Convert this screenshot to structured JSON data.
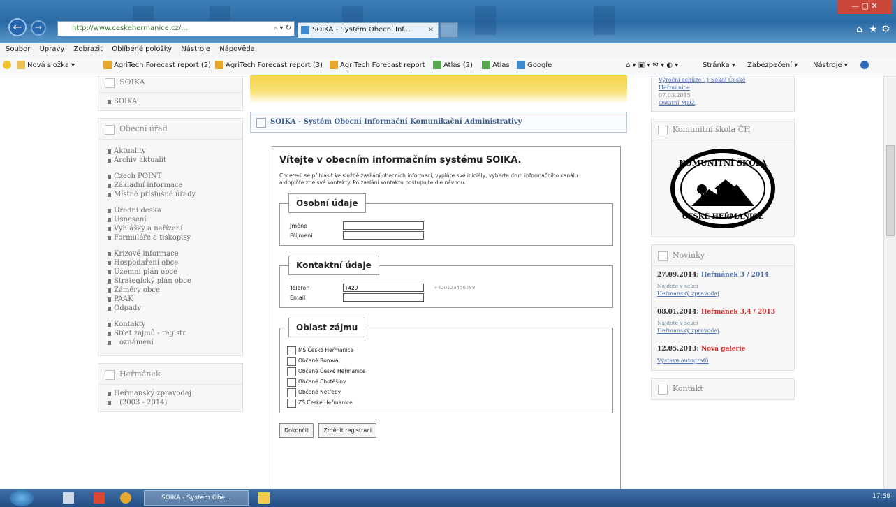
{
  "browser": {
    "address": "http://www.ceskehermanice.cz/...",
    "address_controls": "⌕ ▾ ↻",
    "tab_title": "SOIKA - Systém Obecní Inf...",
    "tab_close": "×",
    "window_controls": "— ▢ ✕"
  },
  "menu": [
    "Soubor",
    "Úpravy",
    "Zobrazit",
    "Oblíbené položky",
    "Nástroje",
    "Nápověda"
  ],
  "favorites": {
    "new_folder": "Nová složka ▾",
    "items": [
      "AgriTech Forecast report (2)",
      "AgriTech Forecast report (3)",
      "AgriTech Forecast report",
      "Atlas (2)",
      "Atlas",
      "Google"
    ],
    "right_tools": [
      "Stránka ▾",
      "Zabezpečení ▾",
      "Nástroje ▾"
    ],
    "icons": "⌂ ▾ ▣ ▾ ✉ ▾ ◐ ▾"
  },
  "left": {
    "soika": {
      "title": "SOIKA",
      "items": [
        "SOIKA"
      ]
    },
    "urad": {
      "title": "Obecní úřad",
      "groups": [
        [
          "Aktuality",
          "Archiv aktualit"
        ],
        [
          "Czech POINT",
          "Základní informace",
          "Místně příslušné úřady"
        ],
        [
          "Úřední deska",
          "Usnesení",
          "Vyhlášky a nařízení",
          "Formuláře a tiskopisy"
        ],
        [
          "Krizové informace",
          "Hospodaření obce",
          "Územní plán obce",
          "Strategický plán obce",
          "Záměry obce",
          "PAAK",
          "Odpady"
        ],
        [
          "Kontakty",
          "Střet zájmů - registr",
          "oznámení"
        ]
      ]
    },
    "hermanek": {
      "title": "Heřmánek",
      "items": [
        "Heřmanský zpravodaj",
        "(2003 - 2014)"
      ]
    }
  },
  "main": {
    "header": "SOIKA - Systém Obecní Informační Komunikační Administrativy",
    "welcome": "Vítejte v obecním informačním systému SOIKA.",
    "intro": "Chcete-li se přihlásit ke službě zasílání obecních informací, vyplňte své iniciály, vyberte druh informačního kanálu a doplňte zde své kontakty. Po zaslání kontaktu postupujte dle návodu.",
    "personal": {
      "legend": "Osobní údaje",
      "jmeno_label": "Jméno",
      "prijmeni_label": "Příjmení",
      "jmeno_value": "",
      "prijmeni_value": ""
    },
    "contact": {
      "legend": "Kontaktní údaje",
      "phone_label": "Telefon",
      "phone_value": "+420",
      "phone_hint": "+420123456789",
      "email_label": "Email",
      "email_value": ""
    },
    "interest": {
      "legend": "Oblast zájmu",
      "options": [
        "MŠ České Heřmanice",
        "Občané Borová",
        "Občané České Heřmanice",
        "Občané Chotěšiny",
        "Občané Netřeby",
        "ZŠ České Heřmanice"
      ]
    },
    "submit": "Dokončit",
    "change": "Změnit registraci"
  },
  "right": {
    "top_links": [
      "Výroční schůze TJ Sokol České",
      "Heřmanice"
    ],
    "top_date": "07.03.2015",
    "top_more": "Ostatní MDŽ",
    "school": {
      "title": "Komunitní škola ČH",
      "logo_top": "KOMUNITNÍ ŠKOLA",
      "logo_bottom": "ČESKÉ HEŘMANICE"
    },
    "news": {
      "title": "Novinky",
      "items": [
        {
          "date": "27.09.2014:",
          "headline": "Heřmánek 3 / 2014",
          "color": "blue",
          "src": "Najdete v sekci",
          "src_link": "Heřmanský zpravodaj"
        },
        {
          "date": "08.01.2014:",
          "headline": "Heřmánek 3,4 / 2013",
          "color": "red",
          "src": "Najdete v sekci",
          "src_link": "Heřmanský zpravodaj"
        },
        {
          "date": "12.05.2013:",
          "headline": "Nová galerie",
          "color": "red",
          "src": "",
          "src_link": "Výstava autografů"
        }
      ]
    },
    "contact": {
      "title": "Kontakt"
    }
  },
  "taskbar": {
    "task": "SOIKA - Systém Obe...",
    "time": "17:58"
  }
}
